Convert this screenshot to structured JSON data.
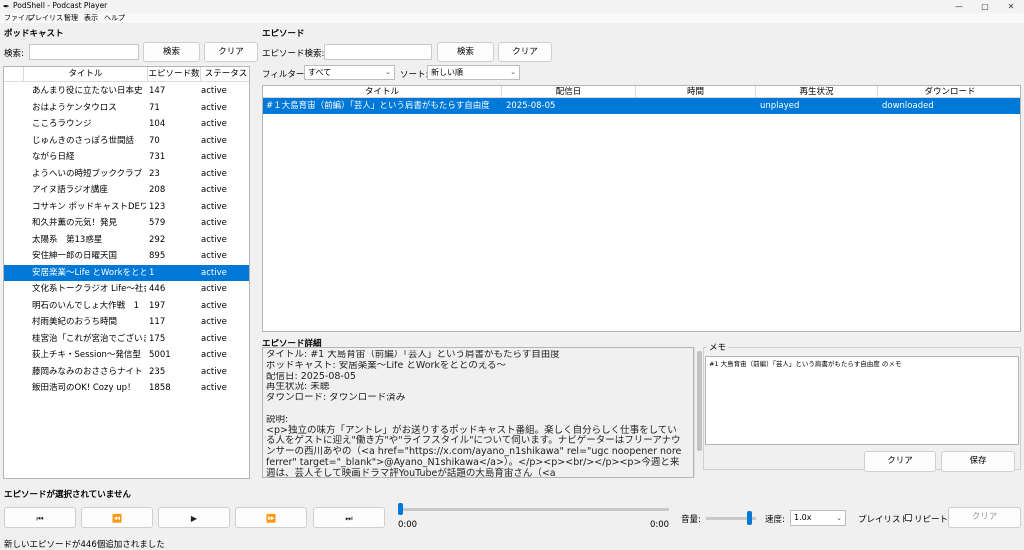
{
  "window": {
    "title": "PodShell - Podcast Player",
    "app_icon": "feather-icon",
    "controls": {
      "minimize": "—",
      "maximize": "▢",
      "close": "✕"
    }
  },
  "menu": [
    "ファイル",
    "プレイリスト",
    "管理",
    "表示",
    "ヘルプ"
  ],
  "podcasts": {
    "section_title": "ポッドキャスト",
    "search_label": "検索:",
    "search_value": "",
    "search_button": "検索",
    "clear_button": "クリア",
    "columns": [
      "タイトル",
      "エピソード数",
      "ステータス"
    ],
    "selected_index": 11,
    "rows": [
      {
        "title": "あんまり役に立たない日本史",
        "count": "147",
        "status": "active"
      },
      {
        "title": "おはようケンタウロス",
        "count": "71",
        "status": "active"
      },
      {
        "title": "こころラウンジ",
        "count": "104",
        "status": "active"
      },
      {
        "title": "じゅんきのさっぽろ世間話",
        "count": "70",
        "status": "active"
      },
      {
        "title": "ながら日経",
        "count": "731",
        "status": "active"
      },
      {
        "title": "ようへいの時短ブッククラブ",
        "count": "23",
        "status": "active"
      },
      {
        "title": "アイヌ語ラジオ講座",
        "count": "208",
        "status": "active"
      },
      {
        "title": "コサキン ポッドキャストDEワァオ",
        "count": "123",
        "status": "active"
      },
      {
        "title": "和久井薫の元気！発見",
        "count": "579",
        "status": "active"
      },
      {
        "title": "太陽系　第13惑星",
        "count": "292",
        "status": "active"
      },
      {
        "title": "安住紳一郎の日曜天国",
        "count": "895",
        "status": "active"
      },
      {
        "title": "安居楽業〜Life とWorkをとと",
        "count": "1",
        "status": "active"
      },
      {
        "title": "文化系トークラジオ Life〜社会",
        "count": "446",
        "status": "active"
      },
      {
        "title": "明石のいんでしょ大作戦　1",
        "count": "197",
        "status": "active"
      },
      {
        "title": "村雨美紀のおうち時間",
        "count": "117",
        "status": "active"
      },
      {
        "title": "桂宮治「これが宮治でございま",
        "count": "175",
        "status": "active"
      },
      {
        "title": "荻上チキ・Session〜発信型",
        "count": "5001",
        "status": "active"
      },
      {
        "title": "藤岡みなみのおささらナイト Po",
        "count": "235",
        "status": "active"
      },
      {
        "title": "飯田浩司のOK! Cozy up！",
        "count": "1858",
        "status": "active"
      }
    ]
  },
  "episodes": {
    "section_title": "エピソード",
    "search_label": "エピソード検索:",
    "search_value": "",
    "search_button": "検索",
    "clear_button": "クリア",
    "filter_label": "フィルター:",
    "filter_value": "すべて",
    "sort_label": "ソート:",
    "sort_value": "新しい順",
    "columns": [
      "タイトル",
      "配信日",
      "時間",
      "再生状況",
      "ダウンロード"
    ],
    "rows": [
      {
        "title": "#１大島育宙（前編）「芸人」という肩書がもたらす自由度",
        "date": "2025-08-05",
        "duration": "",
        "played": "unplayed",
        "download": "downloaded"
      }
    ]
  },
  "detail": {
    "section_title": "エピソード詳細",
    "lines": [
      "タイトル: #1 大島育宙（前編）「芸人」という肩書がもたらす自由度",
      "ポッドキャスト: 安居楽業〜Life とWorkをととのえる〜",
      "配信日: 2025-08-05",
      "再生状況: 未聴",
      "ダウンロード: ダウンロード済み",
      "",
      "説明:"
    ],
    "description": "<p>独立の味方「アントレ」がお送りするポッドキャスト番組。楽しく自分らしく仕事をしている人をゲストに迎え\"働き方\"や\"ライフスタイル\"について伺います。ナビゲーターはフリーアナウンサーの西川あやの（<a href=\"https://x.com/ayano_n1shikawa\" rel=\"ugc noopener noreferrer\" target=\"_blank\">@Ayano_N1shikawa</a>）。</p><p><br/></p><p>今週と来週は、芸人そして映画ドラマ評YouTubeが話題の大島育宙さん（<a"
  },
  "memo": {
    "section_title": "メモ",
    "text": "#1 大島育宙（前編）「芸人」という肩書がもたらす自由度 のメモ",
    "clear_button": "クリア",
    "save_button": "保存"
  },
  "player": {
    "now_playing": "エピソードが選択されていません",
    "buttons": [
      "⏮",
      "⏪",
      "▶",
      "⏩",
      "⏭"
    ],
    "current_time": "0:00",
    "total_time": "0:00",
    "progress": 0,
    "volume_label": "音量:",
    "volume": 0.9,
    "speed_label": "速度:",
    "speed_value": "1.0x",
    "playlist_label": "プレイリスト:",
    "repeat_label": "リピート",
    "repeat_checked": false,
    "clear_button": "クリア"
  },
  "status_bar": "新しいエピソードが446個追加されました"
}
